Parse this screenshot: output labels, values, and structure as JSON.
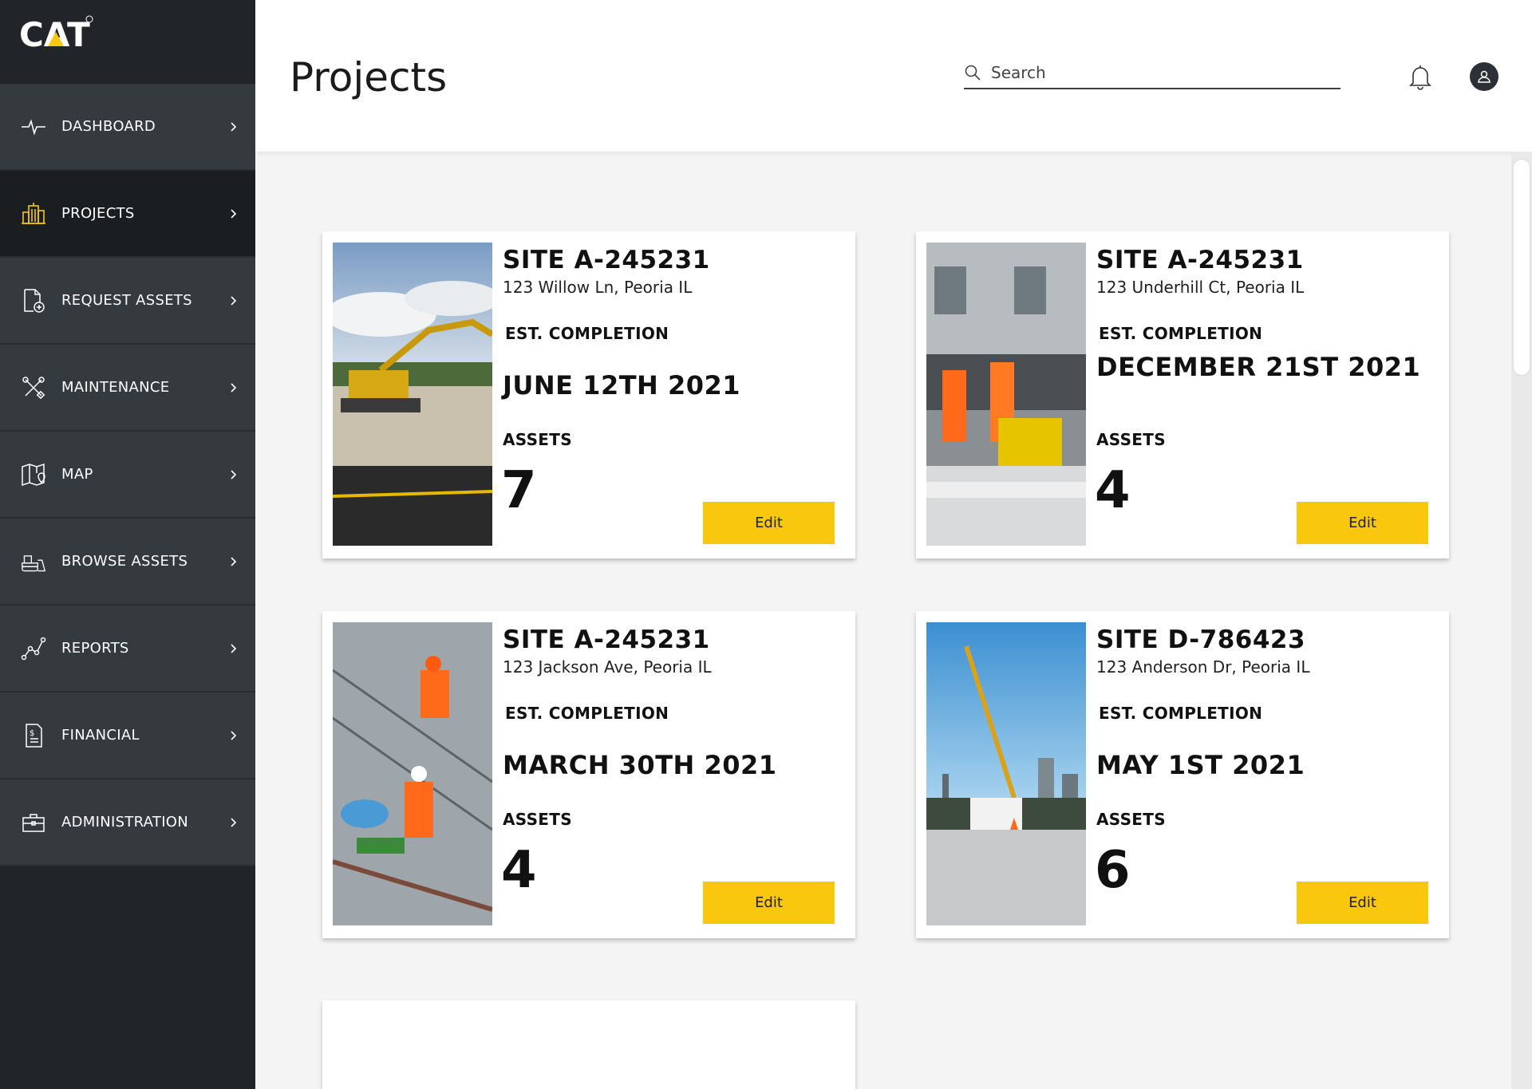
{
  "brand": {
    "logo_text": "CAT",
    "accent": "#f9c80e"
  },
  "sidebar": {
    "items": [
      {
        "label": "DASHBOARD",
        "icon": "pulse-icon",
        "active": false
      },
      {
        "label": "PROJECTS",
        "icon": "buildings-icon",
        "active": true
      },
      {
        "label": "REQUEST ASSETS",
        "icon": "document-add-icon",
        "active": false
      },
      {
        "label": "MAINTENANCE",
        "icon": "tools-icon",
        "active": false
      },
      {
        "label": "MAP",
        "icon": "map-icon",
        "active": false
      },
      {
        "label": "BROWSE ASSETS",
        "icon": "bulldozer-icon",
        "active": false
      },
      {
        "label": "REPORTS",
        "icon": "line-graph-icon",
        "active": false
      },
      {
        "label": "FINANCIAL",
        "icon": "invoice-icon",
        "active": false
      },
      {
        "label": "ADMINISTRATION",
        "icon": "briefcase-icon",
        "active": false
      }
    ]
  },
  "header": {
    "title": "Projects",
    "search_placeholder": "Search"
  },
  "projects": [
    {
      "site": "SITE A-245231",
      "address": "123 Willow Ln, Peoria IL",
      "est_label": "EST. COMPLETION",
      "est_date": "JUNE 12TH 2021",
      "assets_label": "ASSETS",
      "assets": "7",
      "edit_label": "Edit",
      "photo": "excavator-photo"
    },
    {
      "site": "SITE A-245231",
      "address": "123 Underhill Ct, Peoria IL",
      "est_label": "EST. COMPLETION",
      "est_date": "DECEMBER 21ST 2021",
      "assets_label": "ASSETS",
      "assets": "4",
      "edit_label": "Edit",
      "photo": "road-workers-photo"
    },
    {
      "site": "SITE A-245231",
      "address": "123 Jackson Ave, Peoria IL",
      "est_label": "EST. COMPLETION",
      "est_date": "MARCH 30TH 2021",
      "assets_label": "ASSETS",
      "assets": "4",
      "edit_label": "Edit",
      "photo": "construction-workers-photo"
    },
    {
      "site": "SITE D-786423",
      "address": "123 Anderson Dr, Peoria IL",
      "est_label": "EST. COMPLETION",
      "est_date": "MAY 1ST 2021",
      "assets_label": "ASSETS",
      "assets": "6",
      "edit_label": "Edit",
      "photo": "crane-site-photo"
    }
  ]
}
